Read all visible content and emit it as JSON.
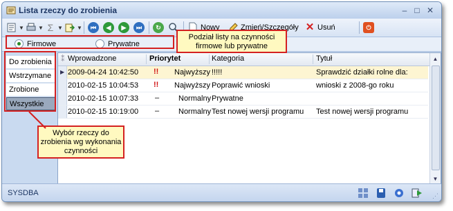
{
  "window": {
    "title": "Lista rzeczy do zrobienia"
  },
  "toolbar": {
    "new_label": "Nowy",
    "edit_label": "Zmień/Szczegóły",
    "delete_label": "Usuń"
  },
  "filter": {
    "firmowe": "Firmowe",
    "prywatne": "Prywatne",
    "selected": "Firmowe"
  },
  "nav": {
    "items": [
      "Do zrobienia",
      "Wstrzymane",
      "Zrobione",
      "Wszystkie"
    ],
    "active": "Wszystkie"
  },
  "table": {
    "columns": [
      "Wprowadzone",
      "Priorytet",
      "Kategoria",
      "Tytuł"
    ],
    "rows": [
      {
        "date": "2009-04-24 10:42:50",
        "prio_icon": "!!",
        "priority": "Najwyższy",
        "category": "!!!!!",
        "title": "Sprawdzić działki rolne dla:"
      },
      {
        "date": "2010-02-15 10:04:53",
        "prio_icon": "!!",
        "priority": "Najwyższy",
        "category": "Poprawić wnioski",
        "title": "wnioski z 2008-go roku"
      },
      {
        "date": "2010-02-15 10:07:33",
        "prio_icon": "–",
        "priority": "Normalny",
        "category": "Prywatne",
        "title": ""
      },
      {
        "date": "2010-02-15 10:19:00",
        "prio_icon": "–",
        "priority": "Normalny",
        "category": "Test nowej wersji programu",
        "title": "Test nowej wersji programu"
      }
    ]
  },
  "callouts": {
    "top": "Podział listy na czynności firmowe lub prywatne",
    "left": "Wybór rzeczy do zrobienia wg wykonania czynności"
  },
  "status": {
    "user": "SYSDBA"
  }
}
